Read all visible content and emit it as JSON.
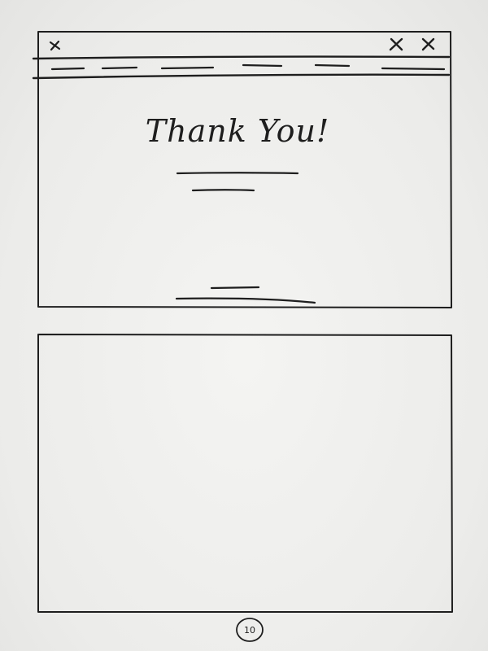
{
  "window_top": {
    "heading": "Thank You!"
  },
  "page_number": "10"
}
